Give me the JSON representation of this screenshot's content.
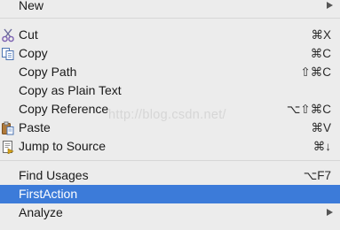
{
  "menu": {
    "items": [
      {
        "label": "New"
      },
      {
        "label": "Cut",
        "shortcut": "⌘X",
        "icon": "scissors-icon"
      },
      {
        "label": "Copy",
        "shortcut": "⌘C",
        "icon": "copy-icon"
      },
      {
        "label": "Copy Path",
        "shortcut": "⇧⌘C"
      },
      {
        "label": "Copy as Plain Text"
      },
      {
        "label": "Copy Reference",
        "shortcut": "⌥⇧⌘C"
      },
      {
        "label": "Paste",
        "shortcut": "⌘V",
        "icon": "paste-icon"
      },
      {
        "label": "Jump to Source",
        "shortcut": "⌘↓",
        "icon": "jump-to-source-icon"
      },
      {
        "label": "Find Usages",
        "shortcut": "⌥F7"
      },
      {
        "label": "FirstAction"
      },
      {
        "label": "Analyze"
      }
    ],
    "selected_item": "FirstAction"
  },
  "watermark": "http://blog.csdn.net/",
  "colors": {
    "background": "#ececec",
    "selection": "#3c7bd9",
    "separator": "#d6d6d6"
  }
}
